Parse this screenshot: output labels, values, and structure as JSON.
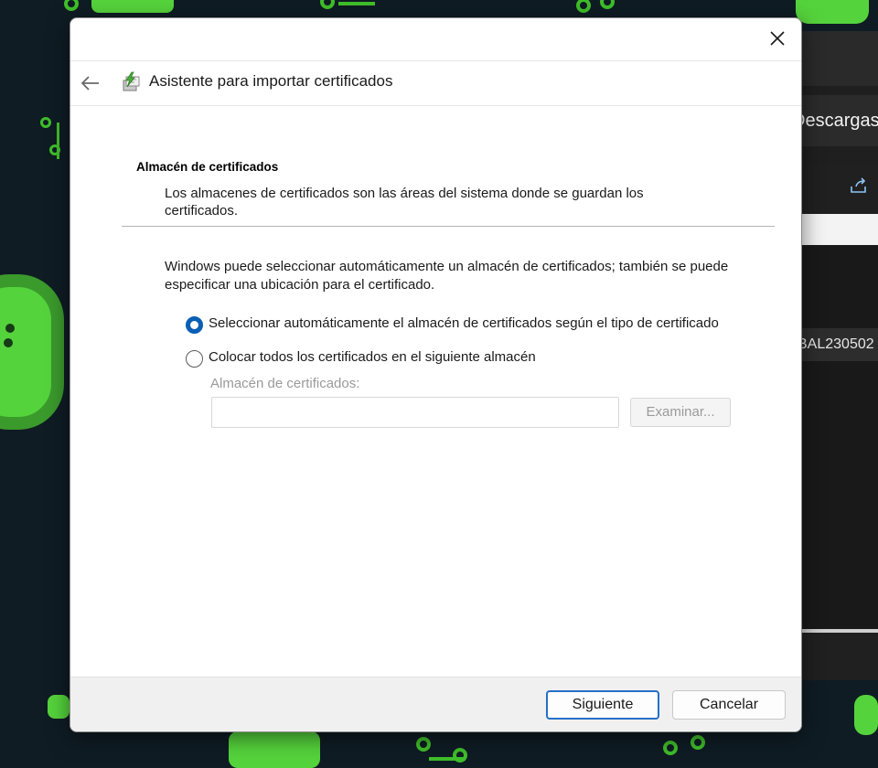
{
  "background_window": {
    "path_text": "Descargas",
    "row_text": "BAL230502",
    "share_icon": "share-icon"
  },
  "dialog": {
    "close_icon": "close-icon",
    "back_icon": "back-arrow-icon",
    "wizard_icon": "certificate-wizard-icon",
    "title": "Asistente para importar certificados",
    "section_title": "Almacén de certificados",
    "section_desc": "Los almacenes de certificados son las áreas del sistema donde se guardan los certificados.",
    "intro": "Windows puede seleccionar automáticamente un almacén de certificados; también se puede especificar una ubicación para el certificado.",
    "options": [
      {
        "label": "Seleccionar automáticamente el almacén de certificados según el tipo de certificado",
        "checked": true
      },
      {
        "label": "Colocar todos los certificados en el siguiente almacén",
        "checked": false
      }
    ],
    "store_label": "Almacén de certificados:",
    "store_value": "",
    "browse_label": "Examinar...",
    "next_label": "Siguiente",
    "cancel_label": "Cancelar"
  },
  "colors": {
    "accent": "#0a5fb4",
    "wallpaper": "#0f1c24",
    "wallpaper_green": "#3fbf2a"
  }
}
